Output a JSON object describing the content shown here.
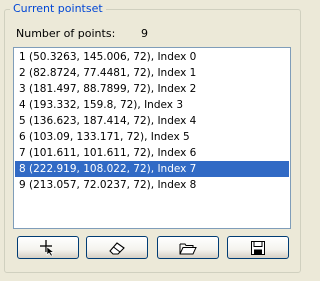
{
  "group": {
    "title": "Current pointset"
  },
  "count": {
    "label": "Number of points:",
    "value": "9"
  },
  "points": [
    {
      "text": "1  (50.3263,  145.006,  72), Index 0",
      "selected": false
    },
    {
      "text": "2  (82.8724,  77.4481,  72), Index 1",
      "selected": false
    },
    {
      "text": "3  (181.497,  88.7899,  72), Index 2",
      "selected": false
    },
    {
      "text": "4  (193.332,  159.8,  72), Index 3",
      "selected": false
    },
    {
      "text": "5  (136.623,  187.414,  72), Index 4",
      "selected": false
    },
    {
      "text": "6  (103.09,  133.171,  72), Index 5",
      "selected": false
    },
    {
      "text": "7  (101.611,  101.611,  72), Index 6",
      "selected": false
    },
    {
      "text": "8  (222.919,  108.022,  72), Index 7",
      "selected": true
    },
    {
      "text": "9  (213.057,  72.0237,  72), Index 8",
      "selected": false
    }
  ],
  "buttons": [
    {
      "name": "add-point-button",
      "icon": "add-point-icon"
    },
    {
      "name": "erase-button",
      "icon": "eraser-icon"
    },
    {
      "name": "open-button",
      "icon": "open-folder-icon"
    },
    {
      "name": "save-button",
      "icon": "save-disk-icon"
    }
  ],
  "colors": {
    "selection": "#316AC5",
    "group_title": "#0046D5",
    "background": "#ECE9D8"
  }
}
